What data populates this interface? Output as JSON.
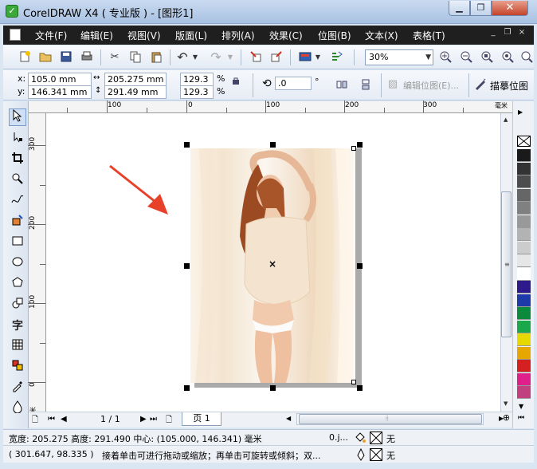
{
  "window": {
    "title": "CorelDRAW X4 ( 专业版 ) - [图形1]",
    "app_icon": "✓",
    "btn_min": "▁",
    "btn_max": "❐",
    "btn_close": "✕"
  },
  "menu": {
    "items": [
      "文件(F)",
      "编辑(E)",
      "视图(V)",
      "版面(L)",
      "排列(A)",
      "效果(C)",
      "位图(B)",
      "文本(X)",
      "表格(T)"
    ],
    "mdi_min": "_",
    "mdi_restore": "❐",
    "mdi_close": "×"
  },
  "toolbar": {
    "icons": [
      "new-icon",
      "open-icon",
      "save-icon",
      "print-icon",
      "cut-icon",
      "copy-icon",
      "paste-icon",
      "undo-icon",
      "redo-icon",
      "import-icon",
      "export-icon",
      "application-launcher-icon",
      "welcome-screen-icon"
    ],
    "zoom_level": "30%",
    "zoom_icons": [
      "zoom-in-icon",
      "zoom-out-icon",
      "zoom-page-icon",
      "zoom-fit-icon",
      "zoom-width-icon"
    ]
  },
  "properties": {
    "x_label": "x:",
    "x_value": "105.0 mm",
    "y_label": "y:",
    "y_value": "146.341 mm",
    "width_value": "205.275 mm",
    "height_value": "291.49 mm",
    "scale_x": "129.3",
    "scale_y": "129.3",
    "percent_1": "%",
    "percent_2": "%",
    "rotation": ".0",
    "degree": "°",
    "edit_bitmap": "编辑位图(E)...",
    "trace_bitmap": "描摹位图"
  },
  "rulers": {
    "h_labels": [
      "100",
      "0",
      "100",
      "200",
      "300"
    ],
    "h_unit": "毫米",
    "v_labels": [
      "300",
      "200",
      "100",
      "0"
    ],
    "v_unit": "毫米"
  },
  "pages": {
    "counter": "1 / 1",
    "tab": "页 1"
  },
  "status": {
    "dimensions": "宽度: 205.275 高度: 291.490 中心: (105.000, 146.341) 毫米",
    "coords": "( 301.647, 98.335 )",
    "hint": "接着单击可进行拖动或缩放；再单击可旋转或倾斜；双...",
    "fill_short": "0.j...",
    "fill_none": "无",
    "outline_none": "无"
  },
  "palette": [
    "#ffffff",
    "#1a1a1a",
    "#333333",
    "#4d4d4d",
    "#666666",
    "#808080",
    "#999999",
    "#b3b3b3",
    "#cccccc",
    "#e6e6e6",
    "#ffffff",
    "#2e1a8a",
    "#1e3aa8",
    "#0a8a3a",
    "#1aa84a",
    "#e6d800",
    "#e6a800",
    "#d42020",
    "#e0208a",
    "#c04080"
  ],
  "colors": {
    "arrow": "#e8412a"
  }
}
